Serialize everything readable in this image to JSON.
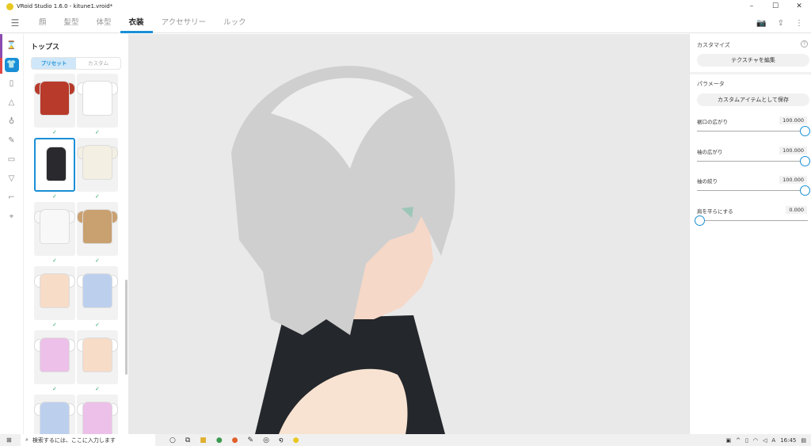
{
  "window": {
    "title": "VRoid Studio 1.6.0 - kitune1.vroid*",
    "minimize": "–",
    "maximize": "☐",
    "close": "✕"
  },
  "tabs": [
    {
      "label": "顔"
    },
    {
      "label": "髪型"
    },
    {
      "label": "体型"
    },
    {
      "label": "衣装"
    },
    {
      "label": "アクセサリー"
    },
    {
      "label": "ルック"
    }
  ],
  "panel": {
    "title": "トップス",
    "segments": [
      "プリセット",
      "カスタム"
    ],
    "items": [
      {
        "color": "#b83a2a",
        "sleeves": "#b83a2a"
      },
      {
        "color": "#ffffff",
        "sleeves": "#ffffff"
      },
      {
        "color": "#2a2a2e",
        "sleeves": ""
      },
      {
        "color": "#f3efe2",
        "sleeves": "#f3efe2"
      },
      {
        "color": "#f8f8f8",
        "sleeves": "#f8f8f8"
      },
      {
        "color": "#c9a070",
        "sleeves": "#c9a070"
      },
      {
        "color": "#f7dcc8",
        "sleeves": "#ffffff"
      },
      {
        "color": "#bcd0ee",
        "sleeves": "#ffffff"
      },
      {
        "color": "#ecc0e8",
        "sleeves": "#ffffff"
      },
      {
        "color": "#f7dcc8",
        "sleeves": "#ffffff"
      },
      {
        "color": "#bcd0ee",
        "sleeves": "#ffffff"
      },
      {
        "color": "#ecc0e8",
        "sleeves": "#ffffff"
      }
    ],
    "check": "✓"
  },
  "right": {
    "customize": "カスタマイズ",
    "edit_texture": "テクスチャを編集",
    "parameters": "パラメータ",
    "save_custom": "カスタムアイテムとして保存",
    "sliders": [
      {
        "label": "裾口の広がり",
        "value": "100.000",
        "fraction": 1
      },
      {
        "label": "袖の広がり",
        "value": "100.000",
        "fraction": 1
      },
      {
        "label": "袖の絞り",
        "value": "100.000",
        "fraction": 1
      },
      {
        "label": "肩を平らにする",
        "value": "0.000",
        "fraction": 0
      }
    ],
    "help": "?"
  },
  "taskbar": {
    "search_placeholder": "検索するには、ここに入力します",
    "time": "16:45",
    "ime": "A"
  },
  "colors": {
    "accent": "#1a8fd6"
  }
}
